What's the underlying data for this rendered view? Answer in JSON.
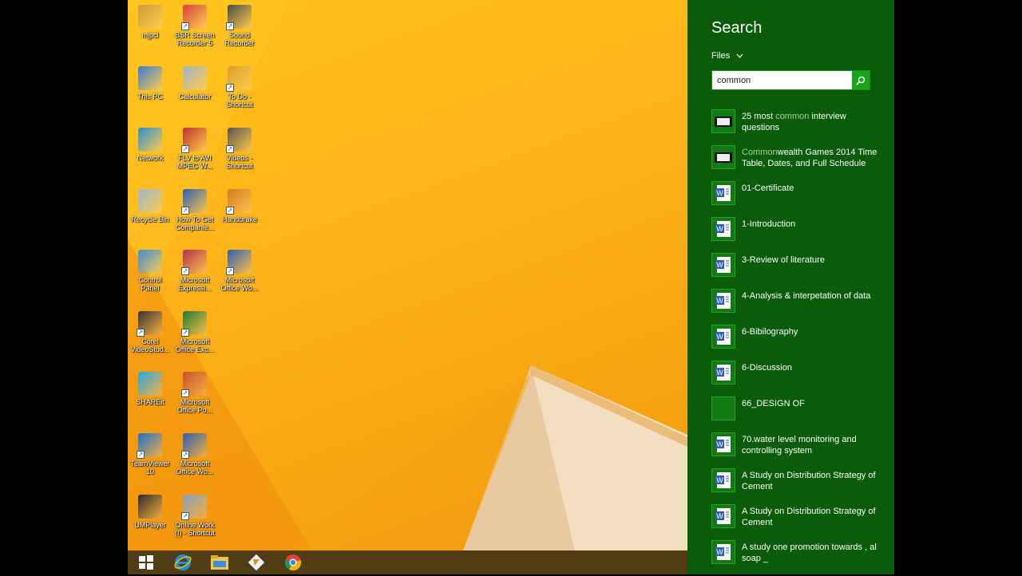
{
  "desktop": {
    "icons": [
      {
        "label": "mjpcl",
        "color": "#c99a3a"
      },
      {
        "label": "BSR Screen\nRecorder 5",
        "color": "#d94040"
      },
      {
        "label": "Sound\nRecorder",
        "color": "#4a4a4a"
      },
      {
        "label": "This PC",
        "color": "#3a7bd5"
      },
      {
        "label": "Calculator",
        "color": "#9fb3c8"
      },
      {
        "label": "To Do -\nShortcut",
        "color": "#d8a030"
      },
      {
        "label": "Network",
        "color": "#2b8fd1"
      },
      {
        "label": "FLV to AVI\nMPEG W...",
        "color": "#c03030"
      },
      {
        "label": "Videos -\nShortcut",
        "color": "#555555"
      },
      {
        "label": "Recycle Bin",
        "color": "#9ab7d0"
      },
      {
        "label": "How To Get\nCompanie...",
        "color": "#2b5fb3"
      },
      {
        "label": "Handbrake",
        "color": "#d07a20"
      },
      {
        "label": "Control\nPanel",
        "color": "#3b8ed8"
      },
      {
        "label": "Microsoft\nExpressi...",
        "color": "#b03050"
      },
      {
        "label": "Microsoft\nOffice Wo...",
        "color": "#2b5fb3"
      },
      {
        "label": "Corel\nVideoStud...",
        "color": "#333333"
      },
      {
        "label": "Microsoft\nOffice Exc...",
        "color": "#1e7b34"
      },
      {
        "label": "SHAREit",
        "color": "#29a8e0"
      },
      {
        "label": "Microsoft\nOffice Po...",
        "color": "#c8502a"
      },
      {
        "label": "TeamViewer\n10",
        "color": "#1c6fd1"
      },
      {
        "label": "Microsoft\nOffice Wo...",
        "color": "#2b5fb3"
      },
      {
        "label": "UMPlayer",
        "color": "#2a2a2a"
      },
      {
        "label": "Online Work\n(I) - Shortcut",
        "color": "#8aa0b8"
      }
    ]
  },
  "taskbar": {
    "items": [
      "start-icon",
      "internet-explorer-icon",
      "file-explorer-icon",
      "app-shortcut-icon",
      "chrome-icon"
    ]
  },
  "search": {
    "title": "Search",
    "scope": "Files",
    "query": "common",
    "results": [
      {
        "pre": "25 most ",
        "hl": "common",
        "post": " interview questions",
        "thumb": "screenshot"
      },
      {
        "pre": "",
        "hl": "Common",
        "post": "wealth Games 2014 Time Table, Dates, and Full Schedule",
        "thumb": "screenshot"
      },
      {
        "pre": "01-Certificate",
        "hl": "",
        "post": "",
        "thumb": "word"
      },
      {
        "pre": "1-Introduction",
        "hl": "",
        "post": "",
        "thumb": "word"
      },
      {
        "pre": "3-Review of literature",
        "hl": "",
        "post": "",
        "thumb": "word"
      },
      {
        "pre": "4-Analysis & interpetation of data",
        "hl": "",
        "post": "",
        "thumb": "word"
      },
      {
        "pre": "6-Bibilography",
        "hl": "",
        "post": "",
        "thumb": "word"
      },
      {
        "pre": "6-Discussion",
        "hl": "",
        "post": "",
        "thumb": "word"
      },
      {
        "pre": "66_DESIGN OF",
        "hl": "",
        "post": "",
        "thumb": "blank"
      },
      {
        "pre": "70.water level monitoring and controlling system",
        "hl": "",
        "post": "",
        "thumb": "word"
      },
      {
        "pre": "A Study on Distribution Strategy of                     Cement",
        "hl": "",
        "post": "",
        "thumb": "word"
      },
      {
        "pre": "A Study on Distribution Strategy of                     Cement",
        "hl": "",
        "post": "",
        "thumb": "word"
      },
      {
        "pre": "A study one promotion towards ,                   al soap           _",
        "hl": "",
        "post": "",
        "thumb": "word"
      }
    ]
  },
  "colors": {
    "charm_bg": "#0a5b0a",
    "accent": "#17a617",
    "highlight": "#9fd39f"
  }
}
